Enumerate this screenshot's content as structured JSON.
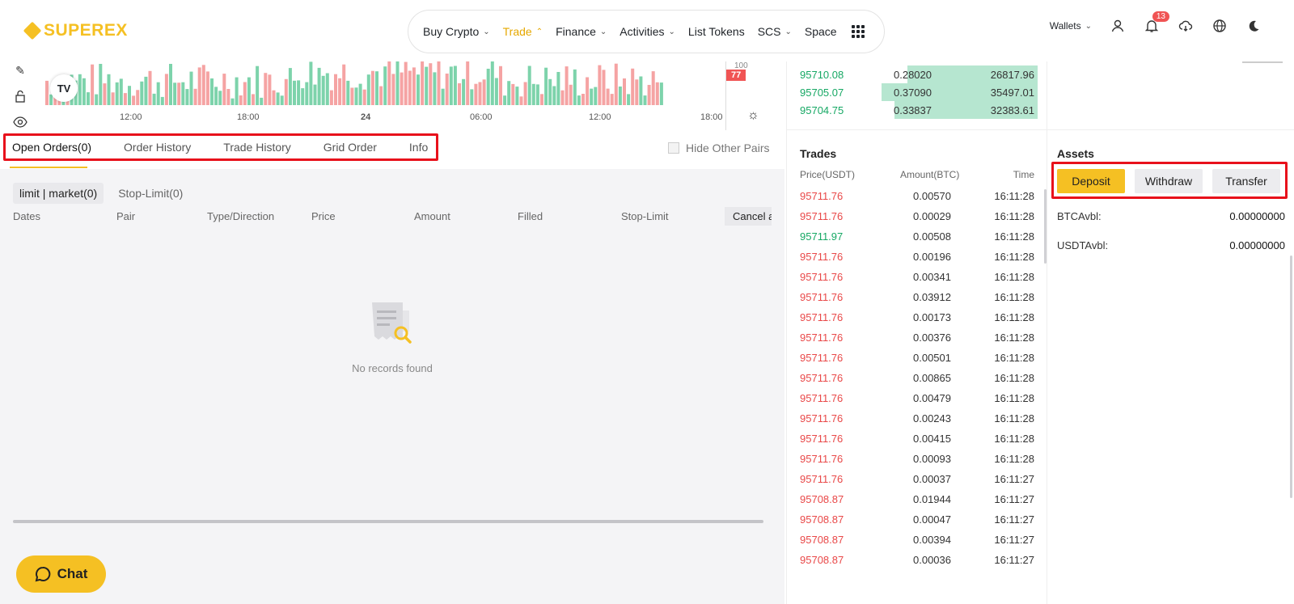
{
  "logo": {
    "text": "SUPEREX"
  },
  "nav": {
    "items": [
      {
        "label": "Buy Crypto",
        "chevron": "chevron-down-icon"
      },
      {
        "label": "Trade",
        "chevron": "chevron-up-icon",
        "active": true
      },
      {
        "label": "Finance",
        "chevron": "chevron-down-icon"
      },
      {
        "label": "Activities",
        "chevron": "chevron-down-icon"
      },
      {
        "label": "List Tokens"
      },
      {
        "label": "SCS",
        "chevron": "chevron-down-icon"
      },
      {
        "label": "Space"
      }
    ]
  },
  "header_tools": {
    "wallets_label": "Wallets",
    "notification_count": "13"
  },
  "chart": {
    "time_labels": [
      "12:00",
      "18:00",
      "24",
      "06:00",
      "12:00",
      "18:00"
    ],
    "price_tag": "77",
    "scale_label": "100",
    "tv_label": "TV"
  },
  "orders": {
    "tabs": [
      "Open Orders(0)",
      "Order History",
      "Trade History",
      "Grid Order",
      "Info"
    ],
    "hide_pairs_label": "Hide Other Pairs",
    "subtabs": [
      "limit | market(0)",
      "Stop-Limit(0)"
    ],
    "columns": [
      "Dates",
      "Pair",
      "Type/Direction",
      "Price",
      "Amount",
      "Filled",
      "Stop-Limit"
    ],
    "cancel_label": "Cancel all",
    "empty_text": "No records found"
  },
  "chat": {
    "label": "Chat"
  },
  "orderbook": {
    "rows": [
      {
        "price": "95710.08",
        "amount": "0.28020",
        "total": "26817.96",
        "depth": 0.5
      },
      {
        "price": "95705.07",
        "amount": "0.37090",
        "total": "35497.01",
        "depth": 0.6
      },
      {
        "price": "95704.75",
        "amount": "0.33837",
        "total": "32383.61",
        "depth": 0.55
      }
    ]
  },
  "trades": {
    "title": "Trades",
    "headers": [
      "Price(USDT)",
      "Amount(BTC)",
      "Time"
    ],
    "rows": [
      {
        "price": "95711.76",
        "amount": "0.00570",
        "time": "16:11:28",
        "side": "sell"
      },
      {
        "price": "95711.76",
        "amount": "0.00029",
        "time": "16:11:28",
        "side": "sell"
      },
      {
        "price": "95711.97",
        "amount": "0.00508",
        "time": "16:11:28",
        "side": "buy"
      },
      {
        "price": "95711.76",
        "amount": "0.00196",
        "time": "16:11:28",
        "side": "sell"
      },
      {
        "price": "95711.76",
        "amount": "0.00341",
        "time": "16:11:28",
        "side": "sell"
      },
      {
        "price": "95711.76",
        "amount": "0.03912",
        "time": "16:11:28",
        "side": "sell"
      },
      {
        "price": "95711.76",
        "amount": "0.00173",
        "time": "16:11:28",
        "side": "sell"
      },
      {
        "price": "95711.76",
        "amount": "0.00376",
        "time": "16:11:28",
        "side": "sell"
      },
      {
        "price": "95711.76",
        "amount": "0.00501",
        "time": "16:11:28",
        "side": "sell"
      },
      {
        "price": "95711.76",
        "amount": "0.00865",
        "time": "16:11:28",
        "side": "sell"
      },
      {
        "price": "95711.76",
        "amount": "0.00479",
        "time": "16:11:28",
        "side": "sell"
      },
      {
        "price": "95711.76",
        "amount": "0.00243",
        "time": "16:11:28",
        "side": "sell"
      },
      {
        "price": "95711.76",
        "amount": "0.00415",
        "time": "16:11:28",
        "side": "sell"
      },
      {
        "price": "95711.76",
        "amount": "0.00093",
        "time": "16:11:28",
        "side": "sell"
      },
      {
        "price": "95711.76",
        "amount": "0.00037",
        "time": "16:11:27",
        "side": "sell"
      },
      {
        "price": "95708.87",
        "amount": "0.01944",
        "time": "16:11:27",
        "side": "sell"
      },
      {
        "price": "95708.87",
        "amount": "0.00047",
        "time": "16:11:27",
        "side": "sell"
      },
      {
        "price": "95708.87",
        "amount": "0.00394",
        "time": "16:11:27",
        "side": "sell"
      },
      {
        "price": "95708.87",
        "amount": "0.00036",
        "time": "16:11:27",
        "side": "sell"
      }
    ]
  },
  "assets": {
    "title": "Assets",
    "buttons": [
      "Deposit",
      "Withdraw",
      "Transfer"
    ],
    "balances": [
      {
        "label": "BTCAvbl:",
        "value": "0.00000000"
      },
      {
        "label": "USDTAvbl:",
        "value": "0.00000000"
      }
    ]
  },
  "colors": {
    "accent": "#f5c023",
    "buy": "#16a864",
    "sell": "#e94848",
    "highlight": "#e8111b"
  }
}
